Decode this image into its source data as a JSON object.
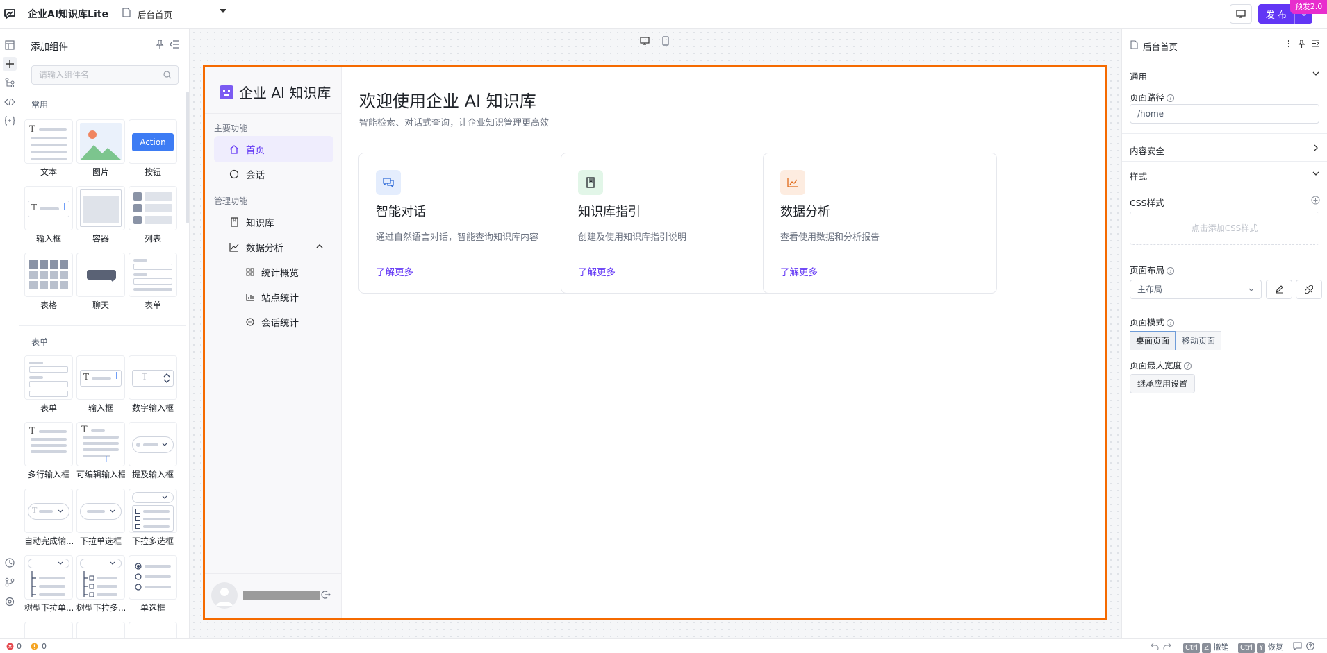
{
  "topbar": {
    "app_title": "企业AI知识库Lite",
    "current_page": "后台首页",
    "publish_label": "发 布",
    "preview_badge": "预发2.0"
  },
  "components_panel": {
    "title": "添加组件",
    "search_placeholder": "请输入组件名",
    "sections": [
      {
        "label": "常用",
        "items": [
          "文本",
          "图片",
          "按钮",
          "输入框",
          "容器",
          "列表",
          "表格",
          "聊天",
          "表单"
        ]
      },
      {
        "label": "表单",
        "items": [
          "表单",
          "输入框",
          "数字输入框",
          "多行输入框",
          "可编辑输入框",
          "提及输入框",
          "自动完成输...",
          "下拉单选框",
          "下拉多选框",
          "树型下拉单...",
          "树型下拉多...",
          "单选框"
        ]
      }
    ],
    "button_thumb_text": "Action"
  },
  "inner_app": {
    "brand": "企业 AI 知识库",
    "groups": {
      "main": "主要功能",
      "manage": "管理功能"
    },
    "nav": {
      "home": "首页",
      "chat": "会话",
      "kb": "知识库",
      "analytics": "数据分析",
      "overview": "统计概览",
      "site_stats": "站点统计",
      "chat_stats": "会话统计"
    },
    "welcome_title": "欢迎使用企业 AI 知识库",
    "welcome_subtitle": "智能检索、对话式查询，让企业知识管理更高效",
    "cards": [
      {
        "title": "智能对话",
        "desc": "通过自然语言对话，智能查询知识库内容",
        "link": "了解更多",
        "icon": "chat-bubbles-icon",
        "color": "#2f6bd8"
      },
      {
        "title": "知识库指引",
        "desc": "创建及使用知识库指引说明",
        "link": "了解更多",
        "icon": "book-icon",
        "color": "#1f2329"
      },
      {
        "title": "数据分析",
        "desc": "查看使用数据和分析报告",
        "link": "了解更多",
        "icon": "line-chart-icon",
        "color": "#e06a1a"
      }
    ]
  },
  "right_panel": {
    "page_title": "后台首页",
    "general": "通用",
    "page_path_label": "页面路径",
    "page_path_value": "/home",
    "content_security": "内容安全",
    "style": "样式",
    "css_label": "CSS样式",
    "css_add": "点击添加CSS样式",
    "layout_label": "页面布局",
    "layout_value": "主布局",
    "mode_label": "页面模式",
    "mode_desktop": "桌面页面",
    "mode_mobile": "移动页面",
    "max_width_label": "页面最大宽度",
    "inherit_btn": "继承应用设置"
  },
  "statusbar": {
    "errors": "0",
    "warnings": "0",
    "undo_key": "Ctrl",
    "undo_key2": "Z",
    "undo_label": "撤销",
    "redo_key": "Ctrl",
    "redo_key2": "Y",
    "redo_label": "恢复"
  },
  "colors": {
    "accent": "#6236f5",
    "frame_border": "#f56a00",
    "badge": "#e82dcd"
  }
}
